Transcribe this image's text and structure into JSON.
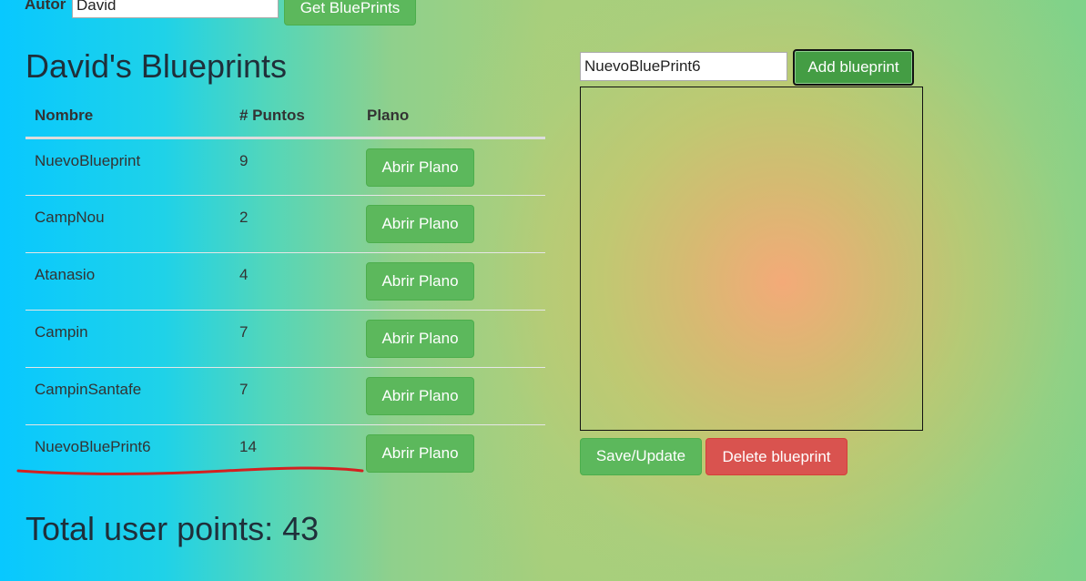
{
  "author_bar": {
    "label": "Autor",
    "input_value": "David",
    "get_button": "Get BluePrints"
  },
  "title": "David's Blueprints",
  "table": {
    "headers": [
      "Nombre",
      "# Puntos",
      "Plano"
    ],
    "rows": [
      {
        "name": "NuevoBlueprint",
        "points": "9",
        "action": "Abrir Plano"
      },
      {
        "name": "CampNou",
        "points": "2",
        "action": "Abrir Plano"
      },
      {
        "name": "Atanasio",
        "points": "4",
        "action": "Abrir Plano"
      },
      {
        "name": "Campin",
        "points": "7",
        "action": "Abrir Plano"
      },
      {
        "name": "CampinSantafe",
        "points": "7",
        "action": "Abrir Plano"
      },
      {
        "name": "NuevoBluePrint6",
        "points": "14",
        "action": "Abrir Plano"
      }
    ]
  },
  "total": "Total user points: 43",
  "editor": {
    "name_input_value": "NuevoBluePrint6",
    "add_button": "Add blueprint",
    "save_button": "Save/Update",
    "delete_button": "Delete blueprint"
  },
  "colors": {
    "success": "#5cb85c",
    "danger": "#d9534f",
    "annotation": "#d42020"
  }
}
